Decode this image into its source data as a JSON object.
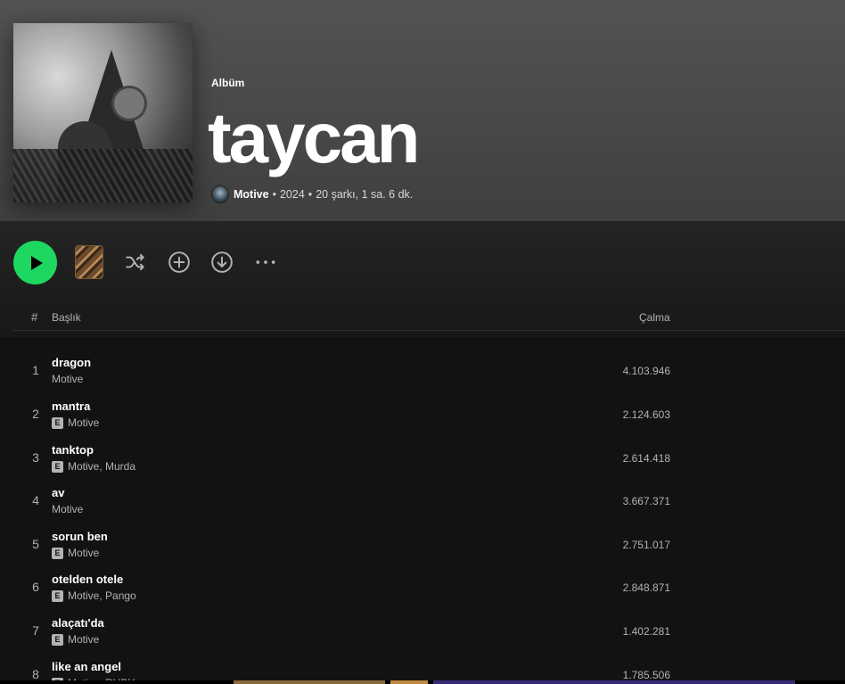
{
  "album": {
    "type_label": "Albüm",
    "title": "taycan",
    "artist": "Motive",
    "year": "2024",
    "summary": "20 şarkı, 1 sa. 6 dk.",
    "separator": "•"
  },
  "controls": {
    "play": "play-icon",
    "shuffle": "shuffle-icon",
    "add": "add-circle-icon",
    "download": "download-icon",
    "more": "more-icon",
    "accent": "#1ed760"
  },
  "list_header": {
    "num": "#",
    "title": "Başlık",
    "plays": "Çalma"
  },
  "tracks": [
    {
      "num": "1",
      "title": "dragon",
      "artists": "Motive",
      "explicit": false,
      "plays": "4.103.946"
    },
    {
      "num": "2",
      "title": "mantra",
      "artists": "Motive",
      "explicit": true,
      "plays": "2.124.603"
    },
    {
      "num": "3",
      "title": "tanktop",
      "artists": "Motive, Murda",
      "explicit": true,
      "plays": "2.614.418"
    },
    {
      "num": "4",
      "title": "av",
      "artists": "Motive",
      "explicit": false,
      "plays": "3.667.371"
    },
    {
      "num": "5",
      "title": "sorun ben",
      "artists": "Motive",
      "explicit": true,
      "plays": "2.751.017"
    },
    {
      "num": "6",
      "title": "otelden otele",
      "artists": "Motive, Pango",
      "explicit": true,
      "plays": "2.848.871"
    },
    {
      "num": "7",
      "title": "alaçatı'da",
      "artists": "Motive",
      "explicit": true,
      "plays": "1.402.281"
    },
    {
      "num": "8",
      "title": "like an angel",
      "artists": "Motive, RUBY",
      "explicit": true,
      "plays": "1.785.506"
    }
  ],
  "explicit_label": "E"
}
